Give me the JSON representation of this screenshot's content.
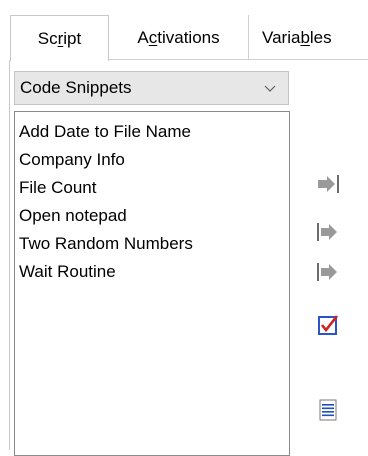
{
  "tabs": [
    {
      "pre": "Sc",
      "mnemonic": "r",
      "post": "ipt"
    },
    {
      "pre": "A",
      "mnemonic": "c",
      "post": "tivations"
    },
    {
      "pre": "Varia",
      "mnemonic": "b",
      "post": "les"
    }
  ],
  "active_tab": "Script",
  "snippet_category": {
    "selected": "Code Snippets",
    "icon": "chevron-down-icon"
  },
  "snippets": [
    "Add Date to File Name",
    "Company Info",
    "File Count",
    "Open notepad",
    "Two Random Numbers",
    "Wait Routine"
  ],
  "side_buttons": [
    {
      "icon": "insert-at-end-arrow-icon"
    },
    {
      "icon": "insert-arrow-icon"
    },
    {
      "icon": "insert-arrow-icon"
    },
    {
      "icon": "edit-checkbox-icon"
    },
    {
      "icon": "document-lines-icon"
    }
  ],
  "colors": {
    "arrow_gray": "#9a9a9a",
    "checkbox_blue": "#2a55c8",
    "check_red": "#d12020",
    "doc_blue": "#1f4fb8"
  }
}
